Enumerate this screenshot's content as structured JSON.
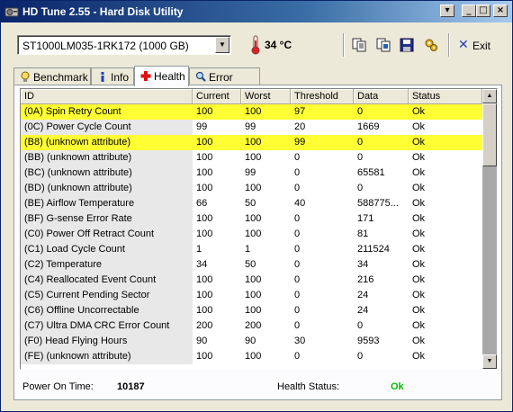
{
  "window": {
    "title": "HD Tune 2.55 - Hard Disk Utility",
    "buttons": {
      "menu": "▾",
      "minimize": "_",
      "maximize": "□",
      "close": "×"
    }
  },
  "toolbar": {
    "drive": "ST1000LM035-1RK172 (1000 GB)",
    "temperature": "34 °C",
    "exit_label": "Exit",
    "icons": [
      "copy-text-icon",
      "copy-screenshot-icon",
      "save-icon",
      "options-icon"
    ]
  },
  "tabs": [
    {
      "label": "Benchmark",
      "icon": "lightbulb-icon"
    },
    {
      "label": "Info",
      "icon": "info-icon"
    },
    {
      "label": "Health",
      "icon": "health-cross-icon",
      "active": true
    },
    {
      "label": "Error Scan",
      "icon": "magnifier-icon"
    }
  ],
  "table": {
    "columns": [
      "ID",
      "Current",
      "Worst",
      "Threshold",
      "Data",
      "Status"
    ],
    "rows": [
      {
        "id": "(0A) Spin Retry Count",
        "current": "100",
        "worst": "100",
        "threshold": "97",
        "data": "0",
        "status": "Ok",
        "highlight": true
      },
      {
        "id": "(0C) Power Cycle Count",
        "current": "99",
        "worst": "99",
        "threshold": "20",
        "data": "1669",
        "status": "Ok"
      },
      {
        "id": "(B8) (unknown attribute)",
        "current": "100",
        "worst": "100",
        "threshold": "99",
        "data": "0",
        "status": "Ok",
        "highlight": true
      },
      {
        "id": "(BB) (unknown attribute)",
        "current": "100",
        "worst": "100",
        "threshold": "0",
        "data": "0",
        "status": "Ok"
      },
      {
        "id": "(BC) (unknown attribute)",
        "current": "100",
        "worst": "99",
        "threshold": "0",
        "data": "65581",
        "status": "Ok"
      },
      {
        "id": "(BD) (unknown attribute)",
        "current": "100",
        "worst": "100",
        "threshold": "0",
        "data": "0",
        "status": "Ok"
      },
      {
        "id": "(BE) Airflow Temperature",
        "current": "66",
        "worst": "50",
        "threshold": "40",
        "data": "588775...",
        "status": "Ok"
      },
      {
        "id": "(BF) G-sense Error Rate",
        "current": "100",
        "worst": "100",
        "threshold": "0",
        "data": "171",
        "status": "Ok"
      },
      {
        "id": "(C0) Power Off Retract Count",
        "current": "100",
        "worst": "100",
        "threshold": "0",
        "data": "81",
        "status": "Ok"
      },
      {
        "id": "(C1) Load Cycle Count",
        "current": "1",
        "worst": "1",
        "threshold": "0",
        "data": "211524",
        "status": "Ok"
      },
      {
        "id": "(C2) Temperature",
        "current": "34",
        "worst": "50",
        "threshold": "0",
        "data": "34",
        "status": "Ok"
      },
      {
        "id": "(C4) Reallocated Event Count",
        "current": "100",
        "worst": "100",
        "threshold": "0",
        "data": "216",
        "status": "Ok"
      },
      {
        "id": "(C5) Current Pending Sector",
        "current": "100",
        "worst": "100",
        "threshold": "0",
        "data": "24",
        "status": "Ok"
      },
      {
        "id": "(C6) Offline Uncorrectable",
        "current": "100",
        "worst": "100",
        "threshold": "0",
        "data": "24",
        "status": "Ok"
      },
      {
        "id": "(C7) Ultra DMA CRC Error Count",
        "current": "200",
        "worst": "200",
        "threshold": "0",
        "data": "0",
        "status": "Ok"
      },
      {
        "id": "(F0) Head Flying Hours",
        "current": "90",
        "worst": "90",
        "threshold": "30",
        "data": "9593",
        "status": "Ok"
      },
      {
        "id": "(FE) (unknown attribute)",
        "current": "100",
        "worst": "100",
        "threshold": "0",
        "data": "0",
        "status": "Ok"
      }
    ]
  },
  "footer": {
    "power_on_label": "Power On Time:",
    "power_on_value": "10187",
    "health_label": "Health Status:",
    "health_value": "Ok"
  },
  "colors": {
    "highlight_row": "#ffff33",
    "health_ok": "#00c000",
    "title_gradient_start": "#0a246a"
  }
}
